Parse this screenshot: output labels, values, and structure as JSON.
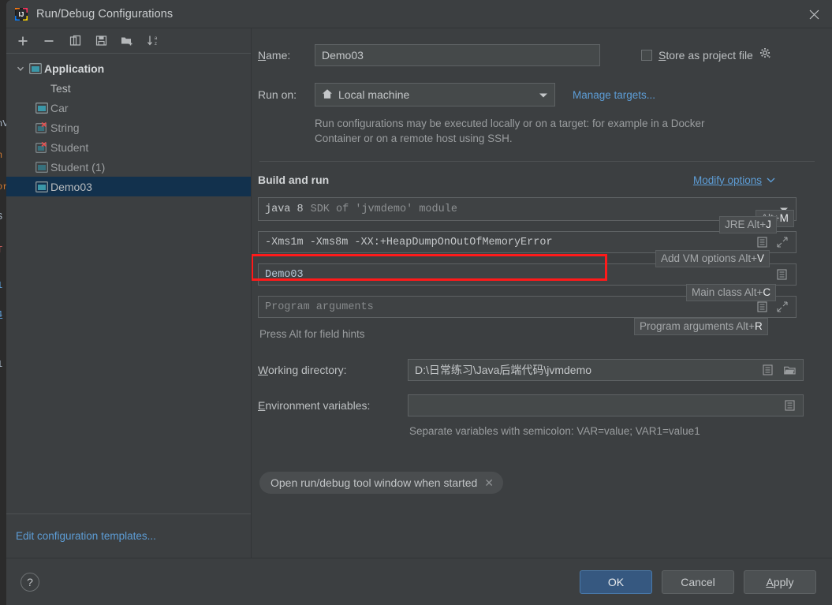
{
  "window": {
    "title": "Run/Debug Configurations",
    "logo_icon": "intellij-idea-logo",
    "close_icon": "close-icon"
  },
  "background_editor": {
    "lines": [
      "nV",
      "n",
      "or",
      "S",
      "T",
      "1",
      "4",
      "1"
    ]
  },
  "sidebar": {
    "toolbar": [
      {
        "name": "add-configuration-button",
        "icon": "plus-icon",
        "glyph": "+"
      },
      {
        "name": "remove-configuration-button",
        "icon": "minus-icon",
        "glyph": "−"
      },
      {
        "name": "copy-configuration-button",
        "icon": "copy-icon",
        "glyph": "copy"
      },
      {
        "name": "save-configuration-button",
        "icon": "save-icon",
        "glyph": "save"
      },
      {
        "name": "new-folder-button",
        "icon": "new-folder-icon",
        "glyph": "folder-plus"
      },
      {
        "name": "sort-configurations-button",
        "icon": "sort-alphabetically-icon",
        "glyph": "sort-az"
      }
    ],
    "tree": [
      {
        "label": "Application",
        "type": "group",
        "icon": "application-icon",
        "expanded": true,
        "selected": false,
        "error": false
      },
      {
        "label": "Test",
        "type": "child-noicon",
        "icon": "",
        "selected": false,
        "error": false
      },
      {
        "label": "Car",
        "type": "child",
        "icon": "application-icon",
        "selected": false,
        "error": false
      },
      {
        "label": "String",
        "type": "child",
        "icon": "application-icon",
        "selected": false,
        "error": true
      },
      {
        "label": "Student",
        "type": "child",
        "icon": "application-icon",
        "selected": false,
        "error": true
      },
      {
        "label": "Student (1)",
        "type": "child",
        "icon": "application-icon",
        "selected": false,
        "error": false
      },
      {
        "label": "Demo03",
        "type": "child",
        "icon": "application-icon",
        "selected": true,
        "error": false
      }
    ],
    "edit_templates_link": "Edit configuration templates..."
  },
  "form": {
    "name_label": "Name:",
    "name_mnemonic": "N",
    "name_value": "Demo03",
    "store_as_project_file_label": "Store as project file",
    "store_as_project_file_mnemonic": "S",
    "store_as_project_file_checked": false,
    "store_gear_icon": "gear-dropdown-icon",
    "run_on_label": "Run on:",
    "run_on_value": "Local machine",
    "run_on_icon": "home-icon",
    "manage_targets_link": "Manage targets...",
    "run_on_description": "Run configurations may be executed locally or on a target: for example in a Docker Container or on a remote host using SSH.",
    "build_and_run_label": "Build and run",
    "modify_options_link": "Modify options",
    "modify_options_mnemonic": "M",
    "jre_value_bold": "java 8",
    "jre_value_dim": "SDK of 'jvmdemo' module",
    "vm_options_value": "-Xms1m -Xms8m -XX:+HeapDumpOnOutOfMemoryError",
    "main_class_value": "Demo03",
    "program_arguments_placeholder": "Program arguments",
    "field_hints_note": "Press Alt for field hints",
    "working_directory_label": "Working directory:",
    "working_directory_mnemonic": "W",
    "working_directory_value": "D:\\日常练习\\Java后端代码\\jvmdemo",
    "environment_variables_label": "Environment variables:",
    "environment_variables_mnemonic": "E",
    "environment_variables_value": "",
    "environment_variables_note": "Separate variables with semicolon: VAR=value; VAR1=value1",
    "chip_label": "Open run/debug tool window when started",
    "chip_close_icon": "close-icon"
  },
  "alt_hints": [
    {
      "name": "modify-options-hint",
      "prefix": "Alt+",
      "key": "M"
    },
    {
      "name": "jre-hint",
      "prefix": "JRE Alt+",
      "key": "J"
    },
    {
      "name": "vm-options-hint",
      "prefix": "Add VM options Alt+",
      "key": "V"
    },
    {
      "name": "main-class-hint",
      "prefix": "Main class Alt+",
      "key": "C"
    },
    {
      "name": "program-arguments-hint",
      "prefix": "Program arguments Alt+",
      "key": "R"
    }
  ],
  "footer": {
    "help_label": "?",
    "ok_label": "OK",
    "cancel_label": "Cancel",
    "apply_label": "Apply",
    "apply_mnemonic": "A"
  },
  "annotation": {
    "type": "red-rectangle-highlight",
    "target": "vm-options-field",
    "color": "#ff1a1a"
  },
  "colors": {
    "dialog_bg": "#3c3f41",
    "field_bg": "#45494a",
    "selection_bg": "#12314d",
    "link": "#5d9dd6",
    "primary_button": "#365880",
    "error_badge": "#e05252",
    "annotation": "#ff1a1a"
  }
}
